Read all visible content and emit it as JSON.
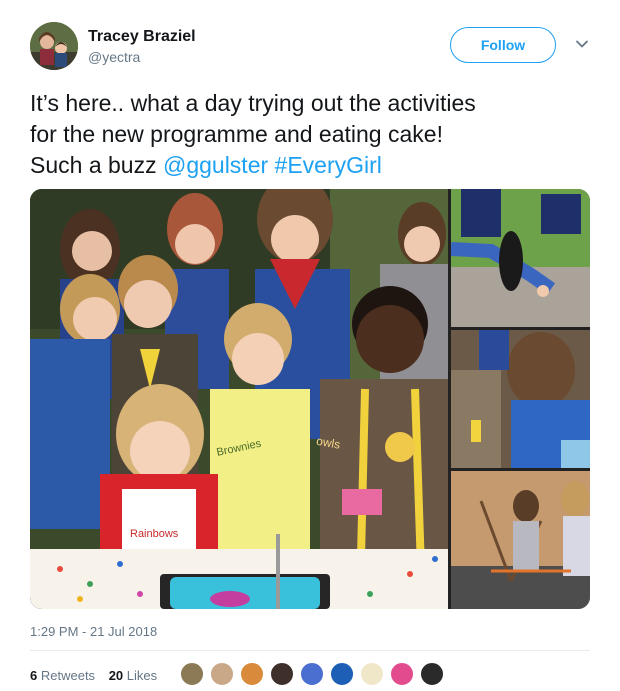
{
  "author": {
    "name": "Tracey Braziel",
    "handle": "@yectra"
  },
  "follow_label": "Follow",
  "tweet": {
    "text_line1": "It’s here.. what a day trying out the activities",
    "text_line2": "for the new programme and eating cake!",
    "text_line3_prefix": "Such a buzz ",
    "mention": "@ggulster",
    "hashtag": "#EveryGirl"
  },
  "media": {
    "main_badges": [
      "Brownies",
      "Rainbows",
      "owls"
    ],
    "count": 4
  },
  "timestamp": "1:29 PM - 21 Jul 2018",
  "stats": {
    "retweets_count": "6",
    "retweets_label": "Retweets",
    "likes_count": "20",
    "likes_label": "Likes"
  },
  "colors": {
    "accent": "#1da1f2",
    "muted": "#657786",
    "text": "#14171a"
  },
  "icons": {
    "caret": "chevron-down-icon"
  }
}
